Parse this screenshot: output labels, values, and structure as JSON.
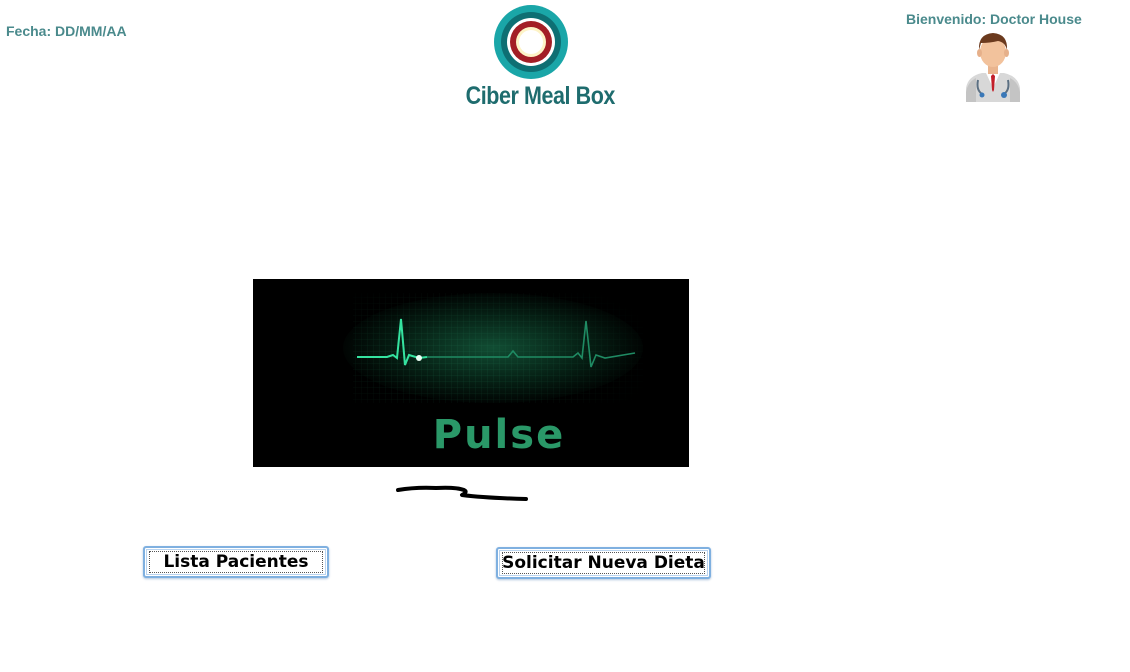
{
  "header": {
    "date_label": "Fecha: DD/MM/AA",
    "welcome_label": "Bienvenido: Doctor House",
    "logo_text": "Ciber Meal Box",
    "avatar_icon": "doctor-avatar-icon"
  },
  "banner": {
    "word": "Pulse",
    "icon": "heartbeat-pulse-icon"
  },
  "actions": {
    "patients_list_label": "Lista Pacientes",
    "request_diet_label": "Solicitar Nueva Dieta"
  },
  "colors": {
    "header_text": "#4a8a8c",
    "logo_teal": "#1e6c6e",
    "pulse_green": "#2a9868",
    "button_border": "#7fb0e0"
  }
}
